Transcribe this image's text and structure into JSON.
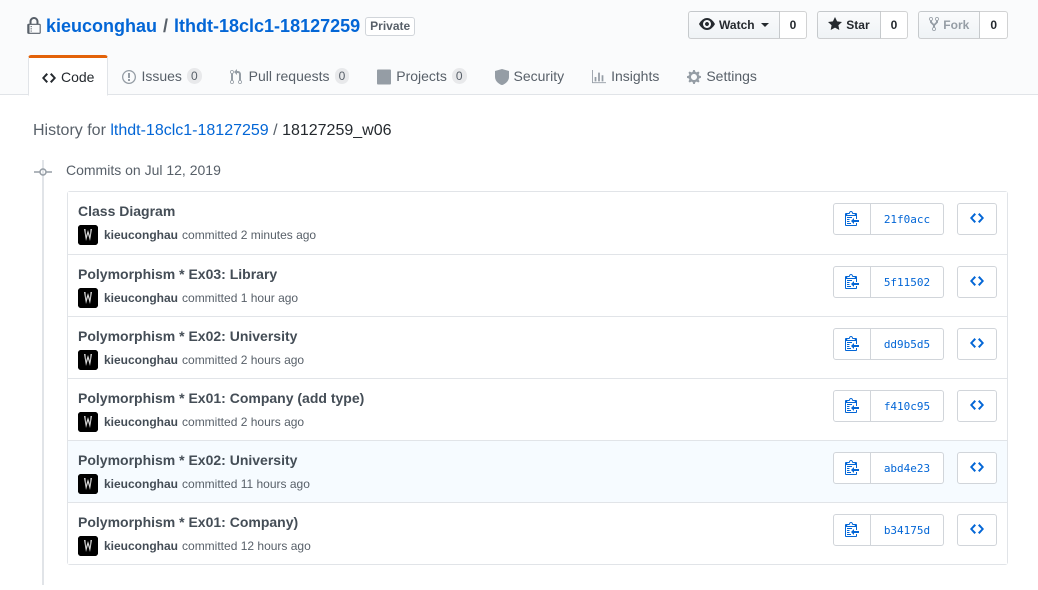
{
  "repo": {
    "owner": "kieuconghau",
    "separator": "/",
    "name": "lthdt-18clc1-18127259",
    "visibility": "Private"
  },
  "actions": {
    "watch": {
      "label": "Watch",
      "count": "0"
    },
    "star": {
      "label": "Star",
      "count": "0"
    },
    "fork": {
      "label": "Fork",
      "count": "0"
    }
  },
  "nav": {
    "code": {
      "label": "Code"
    },
    "issues": {
      "label": "Issues",
      "count": "0"
    },
    "pulls": {
      "label": "Pull requests",
      "count": "0"
    },
    "projects": {
      "label": "Projects",
      "count": "0"
    },
    "security": {
      "label": "Security"
    },
    "insights": {
      "label": "Insights"
    },
    "settings": {
      "label": "Settings"
    }
  },
  "history": {
    "prefix": "History for",
    "repo_link": "lthdt-18clc1-18127259",
    "separator": "/",
    "path": "18127259_w06"
  },
  "group_title": "Commits on Jul 12, 2019",
  "commits": [
    {
      "title": "Class Diagram",
      "author": "kieuconghau",
      "verb": "committed",
      "time": "2 minutes ago",
      "sha": "21f0acc"
    },
    {
      "title": "Polymorphism * Ex03: Library",
      "author": "kieuconghau",
      "verb": "committed",
      "time": "1 hour ago",
      "sha": "5f11502"
    },
    {
      "title": "Polymorphism * Ex02: University",
      "author": "kieuconghau",
      "verb": "committed",
      "time": "2 hours ago",
      "sha": "dd9b5d5"
    },
    {
      "title": "Polymorphism * Ex01: Company (add type)",
      "author": "kieuconghau",
      "verb": "committed",
      "time": "2 hours ago",
      "sha": "f410c95"
    },
    {
      "title": "Polymorphism * Ex02: University",
      "author": "kieuconghau",
      "verb": "committed",
      "time": "11 hours ago",
      "sha": "abd4e23"
    },
    {
      "title": "Polymorphism * Ex01: Company)",
      "author": "kieuconghau",
      "verb": "committed",
      "time": "12 hours ago",
      "sha": "b34175d"
    }
  ],
  "colors": {
    "link": "#0366d6",
    "selected_tab_accent": "#e36209",
    "row_highlight": "#f6fbff"
  }
}
